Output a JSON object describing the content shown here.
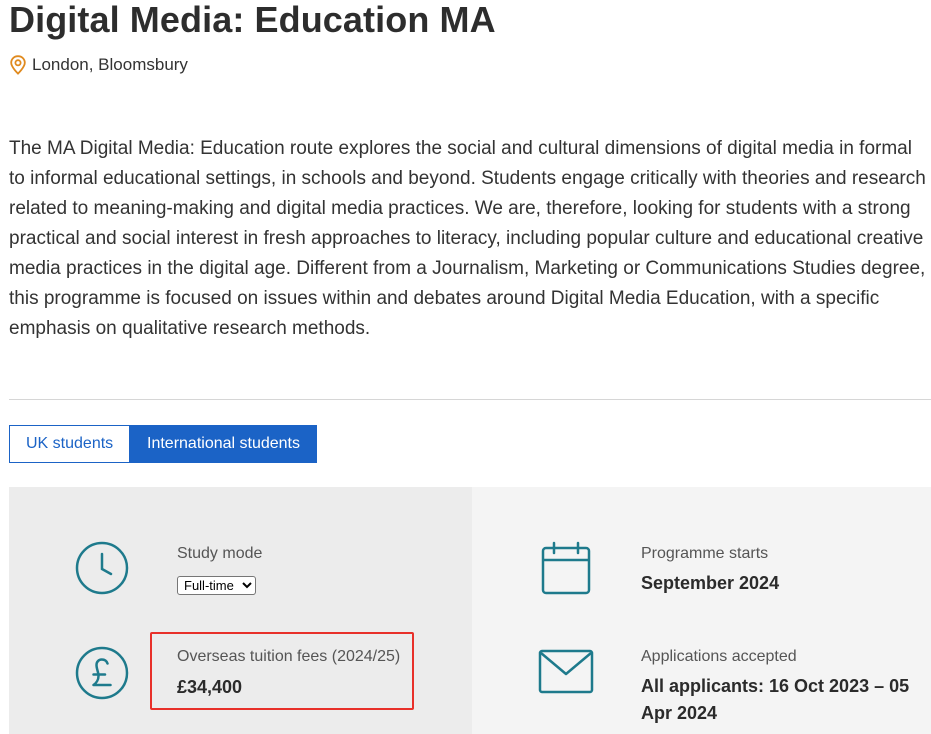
{
  "header": {
    "title": "Digital Media: Education MA",
    "location": "London, Bloomsbury",
    "location_icon": "map-pin-icon"
  },
  "intro": {
    "text": "The MA Digital Media: Education route explores the social and cultural dimensions of digital media in formal to informal educational settings, in schools and beyond. Students engage critically with theories and research related to meaning-making and digital media practices. We are, therefore, looking for students with a strong practical and social interest in fresh approaches to literacy, including popular culture and educational creative media practices in the digital age. Different from a Journalism, Marketing or Communications Studies degree, this programme is focused on issues within and debates around Digital Media Education, with a specific emphasis on qualitative research methods."
  },
  "tabs": [
    {
      "label": "UK students",
      "active": false
    },
    {
      "label": "International students",
      "active": true
    }
  ],
  "facts": {
    "study_mode": {
      "label": "Study mode",
      "icon": "clock-icon",
      "selected": "Full-time",
      "options": [
        "Full-time"
      ]
    },
    "tuition": {
      "label": "Overseas tuition fees (2024/25)",
      "icon": "pound-icon",
      "value": "£34,400"
    },
    "programme_starts": {
      "label": "Programme starts",
      "icon": "calendar-icon",
      "value": "September 2024"
    },
    "applications": {
      "label": "Applications accepted",
      "icon": "envelope-icon",
      "value": "All applicants: 16 Oct 2023 – 05 Apr 2024"
    }
  },
  "colors": {
    "accent_blue": "#1b63c6",
    "icon_teal": "#1e7a8c",
    "pin_orange": "#e08a1e",
    "highlight_red": "#e8302a",
    "panel_left_bg": "#ececec",
    "panel_right_bg": "#f4f4f4"
  }
}
